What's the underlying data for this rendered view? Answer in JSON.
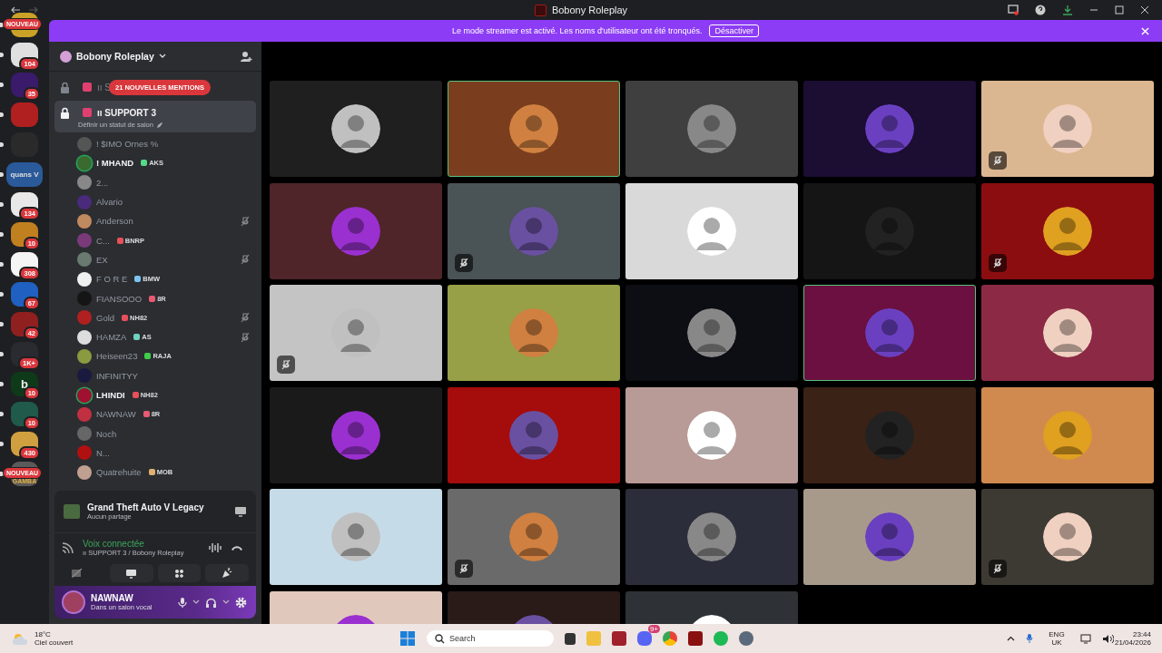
{
  "window": {
    "title": "Bobony Roleplay"
  },
  "banner": {
    "text": "Le mode streamer est activé. Les noms d'utilisateur ont été tronqués.",
    "button": "Désactiver"
  },
  "servers": [
    {
      "unread": true,
      "new_label": "NOUVEAU"
    },
    {
      "unread": true,
      "badge": "104"
    },
    {
      "unread": true,
      "badge": "35"
    },
    {
      "unread": true
    },
    {
      "unread": true
    },
    {
      "unread": true,
      "label": "quans V"
    },
    {
      "unread": true,
      "badge": "134"
    },
    {
      "unread": true,
      "badge": "10"
    },
    {
      "unread": true,
      "badge": "308"
    },
    {
      "unread": true,
      "badge": "67"
    },
    {
      "unread": true,
      "badge": "42"
    },
    {
      "unread": true,
      "badge": "1K+"
    },
    {
      "unread": true,
      "badge": "10",
      "label": "b"
    },
    {
      "unread": true,
      "badge": "10"
    },
    {
      "unread": true,
      "badge": "430"
    },
    {
      "unread": true,
      "new_label": "NOUVEAU",
      "label": "GAMBA"
    }
  ],
  "server_name": "Bobony Roleplay",
  "mentions": "21 NOUVELLES MENTIONS",
  "channels": [
    {
      "name": "ıı S",
      "selected": false
    },
    {
      "name": "ıı SUPPORT 3",
      "status": "Définir un statut de salon",
      "selected": true
    }
  ],
  "members": [
    {
      "name": "! $IMO Ornes %",
      "muted": false,
      "speaking": false
    },
    {
      "name": "! MHAND",
      "tag": {
        "text": "AKS",
        "color": "#57d98a"
      },
      "muted": false,
      "speaking": true
    },
    {
      "name": "2...",
      "muted": false,
      "speaking": false
    },
    {
      "name": "Alvario",
      "muted": false,
      "speaking": false
    },
    {
      "name": "Anderson",
      "muted": true,
      "speaking": false
    },
    {
      "name": "C...",
      "tag": {
        "text": "BNRP",
        "color": "#e8505b"
      },
      "muted": false,
      "speaking": false
    },
    {
      "name": "EX",
      "muted": true,
      "speaking": false
    },
    {
      "name": "F O R E",
      "tag": {
        "text": "BMW",
        "color": "#7cc4f0"
      },
      "muted": false,
      "speaking": false
    },
    {
      "name": "FIANSOOO",
      "tag": {
        "text": "8R",
        "color": "#e85a72"
      },
      "muted": false,
      "speaking": false
    },
    {
      "name": "Gold",
      "tag": {
        "text": "NH82",
        "color": "#e8505b"
      },
      "muted": true,
      "speaking": false
    },
    {
      "name": "HAMZA",
      "tag": {
        "text": "AS",
        "color": "#6fd3c0"
      },
      "muted": true,
      "speaking": false
    },
    {
      "name": "Heiseen23",
      "tag": {
        "text": "RAJA",
        "color": "#3ecf4a"
      },
      "muted": false,
      "speaking": false
    },
    {
      "name": "INFINITYY",
      "muted": false,
      "speaking": false
    },
    {
      "name": "LHINDI",
      "tag": {
        "text": "NH82",
        "color": "#e8505b"
      },
      "muted": false,
      "speaking": true
    },
    {
      "name": "NAWNAW",
      "tag": {
        "text": "8R",
        "color": "#e85a72"
      },
      "muted": false,
      "speaking": false
    },
    {
      "name": "Noch",
      "muted": false,
      "speaking": false
    },
    {
      "name": "N...",
      "muted": false,
      "speaking": false
    },
    {
      "name": "Quatrehuite",
      "tag": {
        "text": "MOB",
        "color": "#e0b070"
      },
      "muted": false,
      "speaking": false
    }
  ],
  "activity": {
    "game": "Grand Theft Auto V Legacy",
    "status": "Aucun partage"
  },
  "voice": {
    "status": "Voix connectée",
    "channel": "ıı SUPPORT 3 / Bobony Roleplay"
  },
  "user": {
    "name": "NAWNAW",
    "status": "Dans un salon vocal"
  },
  "tiles": [
    {
      "color": "#1f1f1f",
      "muted": false,
      "speaking": false
    },
    {
      "color": "#7a3e1e",
      "muted": false,
      "speaking": true
    },
    {
      "color": "#3f3f3f",
      "muted": false,
      "speaking": false
    },
    {
      "color": "#1c0d33",
      "muted": false,
      "speaking": false
    },
    {
      "color": "#dbb791",
      "muted": true,
      "speaking": false
    },
    {
      "color": "#4f2529",
      "muted": false,
      "speaking": false
    },
    {
      "color": "#4a5355",
      "muted": true,
      "speaking": false
    },
    {
      "color": "#d9d9d9",
      "muted": false,
      "speaking": false
    },
    {
      "color": "#151515",
      "muted": false,
      "speaking": false
    },
    {
      "color": "#8b0d10",
      "muted": true,
      "speaking": false
    },
    {
      "color": "#c4c4c4",
      "muted": true,
      "speaking": false
    },
    {
      "color": "#97a046",
      "muted": false,
      "speaking": false
    },
    {
      "color": "#0d0d14",
      "muted": false,
      "speaking": false
    },
    {
      "color": "#6b1040",
      "muted": false,
      "speaking": true
    },
    {
      "color": "#8c2a45",
      "muted": false,
      "speaking": false
    },
    {
      "color": "#1a1a1a",
      "muted": false,
      "speaking": false
    },
    {
      "color": "#a50c0c",
      "muted": false,
      "speaking": false
    },
    {
      "color": "#b89a96",
      "muted": false,
      "speaking": false
    },
    {
      "color": "#3b2216",
      "muted": false,
      "speaking": false
    },
    {
      "color": "#d08a50",
      "muted": false,
      "speaking": false
    },
    {
      "color": "#c6dbe8",
      "muted": false,
      "speaking": false
    },
    {
      "color": "#6a6a6a",
      "muted": true,
      "speaking": false
    },
    {
      "color": "#2c2d3a",
      "muted": false,
      "speaking": false
    },
    {
      "color": "#a89a8a",
      "muted": false,
      "speaking": false
    },
    {
      "color": "#3d3a33",
      "muted": true,
      "speaking": false
    },
    {
      "color": "#e0c8bc",
      "muted": false,
      "speaking": false
    },
    {
      "color": "#2a1a18",
      "muted": false,
      "speaking": false
    },
    {
      "color": "#2e3236",
      "muted": false,
      "speaking": false
    }
  ],
  "taskbar": {
    "temperature": "18°C",
    "weather": "Ciel couvert",
    "search": {
      "placeholder": "Search"
    },
    "discord_badge": "9+",
    "lang": "ENG",
    "region": "UK",
    "time": "23:44",
    "date": "21/04/2026"
  }
}
